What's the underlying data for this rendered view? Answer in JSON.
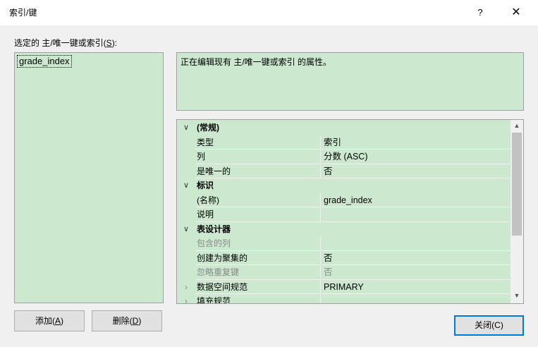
{
  "window": {
    "title": "索引/键",
    "help_glyph": "?",
    "close_glyph": "✕"
  },
  "list": {
    "label_prefix": "选定的 主/唯一键或索引(",
    "label_access": "S",
    "label_suffix": "):",
    "items": [
      "grade_index"
    ]
  },
  "description": {
    "text": "正在编辑现有 主/唯一键或索引 的属性。"
  },
  "properties": {
    "categories": [
      {
        "label": "(常规)",
        "expanded": true
      },
      {
        "label": "标识",
        "expanded": true
      },
      {
        "label": "表设计器",
        "expanded": true
      }
    ],
    "general": [
      {
        "name": "类型",
        "value": "索引"
      },
      {
        "name": "列",
        "value": "分数 (ASC)"
      },
      {
        "name": "是唯一的",
        "value": "否"
      }
    ],
    "identity": [
      {
        "name": "(名称)",
        "value": "grade_index"
      },
      {
        "name": "说明",
        "value": ""
      }
    ],
    "designer": [
      {
        "name": "包含的列",
        "value": "",
        "disabled": true
      },
      {
        "name": "创建为聚集的",
        "value": "否"
      },
      {
        "name": "忽略重复键",
        "value": "否",
        "disabled": true
      },
      {
        "name": "数据空间规范",
        "value": "PRIMARY",
        "expandable": true
      },
      {
        "name": "填充规范",
        "value": "",
        "expandable": true
      }
    ],
    "expander_glyph": "›",
    "collapse_glyph": "∨"
  },
  "scrollbar": {
    "up_glyph": "▲",
    "down_glyph": "▼"
  },
  "buttons": {
    "add_prefix": "添加(",
    "add_access": "A",
    "add_suffix": ")",
    "delete_prefix": "删除(",
    "delete_access": "D",
    "delete_suffix": ")",
    "close_label": "关闭(C)"
  }
}
